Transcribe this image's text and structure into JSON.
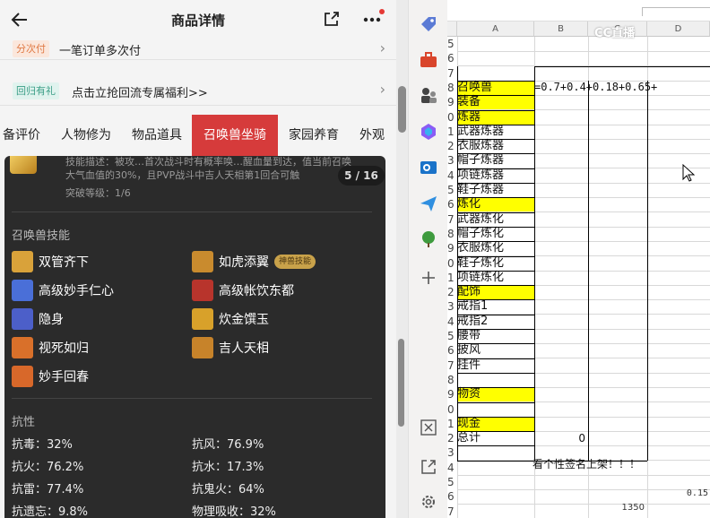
{
  "phone": {
    "header": {
      "title": "商品详情"
    },
    "rows": [
      {
        "tag": "分次付",
        "text": "一笔订单多次付"
      },
      {
        "tag": "回归有礼",
        "text": "点击立抢回流专属福利>>"
      }
    ],
    "tabs": [
      {
        "label": "备评价",
        "active": false
      },
      {
        "label": "人物修为",
        "active": false
      },
      {
        "label": "物品道具",
        "active": false
      },
      {
        "label": "召唤兽坐骑",
        "active": true
      },
      {
        "label": "家园养育",
        "active": false
      },
      {
        "label": "外观",
        "active": false
      }
    ],
    "panel": {
      "desc_line1": "技能描述：被攻…首次战斗时有概率唤…醒血量到达，值当前召唤",
      "desc_line2": "大气血值的30%，且PVP战斗中吉人天相第1回合可触",
      "breakthrough": "突破等级：1/6",
      "counter": "5 / 16",
      "skills_title": "召唤兽技能",
      "skills": [
        {
          "name": "双管齐下",
          "icon": "double-strike-skill-icon",
          "color": "#d9a23a"
        },
        {
          "name": "如虎添翼",
          "icon": "tiger-wings-skill-icon",
          "color": "#c98b2e",
          "badge": "神兽技能"
        },
        {
          "name": "高级妙手仁心",
          "icon": "healing-hand-skill-icon",
          "color": "#4a6fd8"
        },
        {
          "name": "高级帐饮东都",
          "icon": "banquet-skill-icon",
          "color": "#b8342c"
        },
        {
          "name": "隐身",
          "icon": "stealth-skill-icon",
          "color": "#4c5fc9"
        },
        {
          "name": "炊金馔玉",
          "icon": "gold-feast-skill-icon",
          "color": "#d8a12a"
        },
        {
          "name": "视死如归",
          "icon": "fearless-skill-icon",
          "color": "#d9702a"
        },
        {
          "name": "吉人天相",
          "icon": "fortune-skill-icon",
          "color": "#c7832a"
        },
        {
          "name": "妙手回春",
          "icon": "revive-skill-icon",
          "color": "#d8682a"
        }
      ],
      "resist_title": "抗性",
      "resist": [
        {
          "label": "抗毒：32%"
        },
        {
          "label": "抗风：76.9%"
        },
        {
          "label": "抗火：76.2%"
        },
        {
          "label": "抗水：17.3%"
        },
        {
          "label": "抗雷：77.4%"
        },
        {
          "label": "抗鬼火：64%"
        },
        {
          "label": "抗遗忘：9.8%"
        },
        {
          "label": "物理吸收：32%"
        }
      ]
    }
  },
  "sidebar": {
    "icons": [
      "tag-icon",
      "toolbox-icon",
      "chess-icon",
      "copilot-icon",
      "outlook-icon",
      "send-icon",
      "tree-icon",
      "add-icon",
      "screenshot-icon",
      "open-external-icon",
      "settings-icon"
    ]
  },
  "sheet": {
    "columns": [
      "A",
      "B",
      "C",
      "D"
    ],
    "watermark": "CC直播",
    "formula_cell": "=0.7+0.4+0.18+0.65+",
    "rows": [
      {
        "num": "5",
        "a": "",
        "hl": false
      },
      {
        "num": "6",
        "a": "",
        "hl": false
      },
      {
        "num": "7",
        "a": "",
        "hl": false
      },
      {
        "num": "8",
        "a": "召唤兽",
        "hl": true
      },
      {
        "num": "9",
        "a": "装备",
        "hl": true
      },
      {
        "num": "0",
        "a": "炼器",
        "hl": true
      },
      {
        "num": "1",
        "a": "武器炼器",
        "hl": false
      },
      {
        "num": "2",
        "a": "衣服炼器",
        "hl": false
      },
      {
        "num": "3",
        "a": "帽子炼器",
        "hl": false
      },
      {
        "num": "4",
        "a": "项链炼器",
        "hl": false
      },
      {
        "num": "5",
        "a": "鞋子炼器",
        "hl": false
      },
      {
        "num": "6",
        "a": "炼化",
        "hl": true
      },
      {
        "num": "7",
        "a": "武器炼化",
        "hl": false
      },
      {
        "num": "8",
        "a": "帽子炼化",
        "hl": false
      },
      {
        "num": "9",
        "a": "衣服炼化",
        "hl": false
      },
      {
        "num": "0",
        "a": "鞋子炼化",
        "hl": false
      },
      {
        "num": "1",
        "a": "项链炼化",
        "hl": false
      },
      {
        "num": "2",
        "a": "配饰",
        "hl": true
      },
      {
        "num": "3",
        "a": "戒指1",
        "hl": false
      },
      {
        "num": "4",
        "a": "戒指2",
        "hl": false
      },
      {
        "num": "5",
        "a": "腰带",
        "hl": false
      },
      {
        "num": "6",
        "a": "披风",
        "hl": false
      },
      {
        "num": "7",
        "a": "挂件",
        "hl": false
      },
      {
        "num": "8",
        "a": "",
        "hl": false
      },
      {
        "num": "9",
        "a": "物资",
        "hl": true
      },
      {
        "num": "0",
        "a": "",
        "hl": false
      },
      {
        "num": "1",
        "a": "现金",
        "hl": true
      },
      {
        "num": "2",
        "a": "总计",
        "hl": false
      },
      {
        "num": "3",
        "a": "",
        "hl": false
      },
      {
        "num": "4",
        "a": "",
        "hl": false
      },
      {
        "num": "5",
        "a": "",
        "hl": false
      },
      {
        "num": "6",
        "a": "",
        "hl": false
      },
      {
        "num": "7",
        "a": "",
        "hl": false
      }
    ],
    "total_b": "0",
    "banner": "看个性签名上架！！！",
    "d36": "0.15",
    "c37": "1350"
  }
}
